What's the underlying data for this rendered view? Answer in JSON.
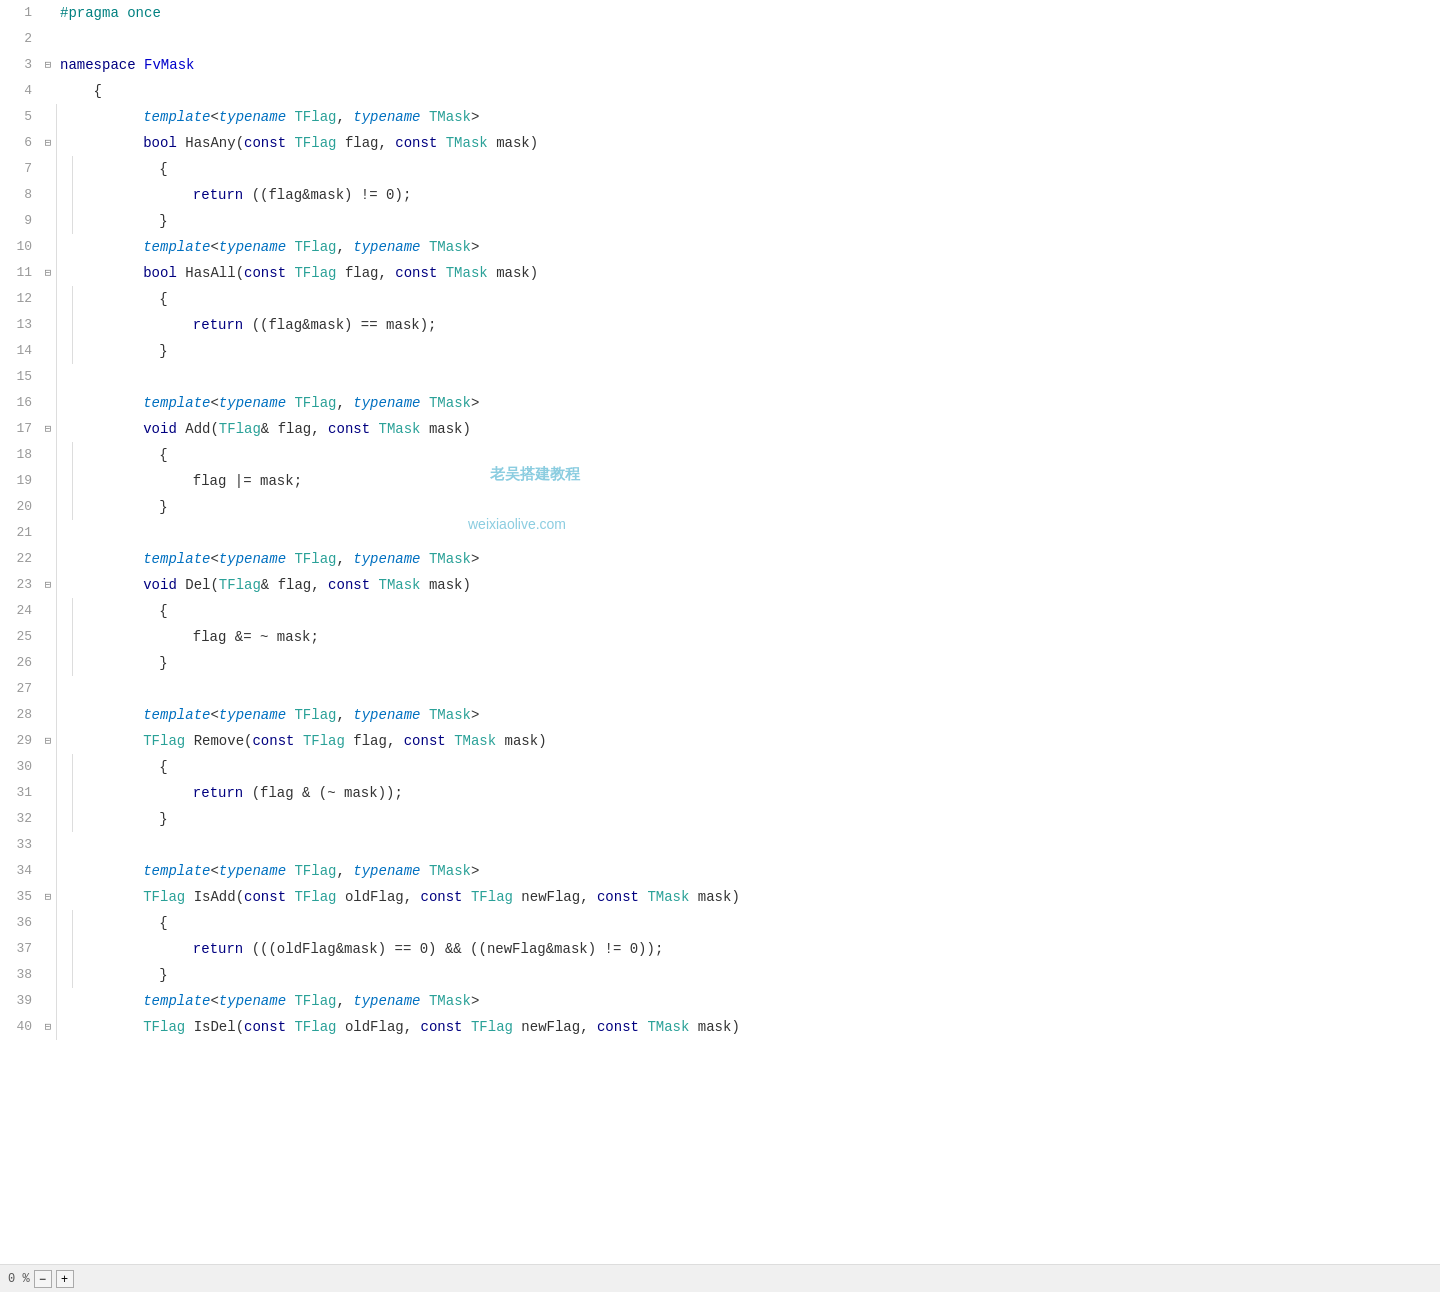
{
  "editor": {
    "lines": [
      {
        "num": "1",
        "fold": "",
        "indent": 0,
        "tokens": [
          {
            "t": "kw-pragma",
            "v": "#pragma once"
          }
        ]
      },
      {
        "num": "2",
        "fold": "",
        "indent": 0,
        "tokens": []
      },
      {
        "num": "3",
        "fold": "⊟",
        "indent": 0,
        "tokens": [
          {
            "t": "kw-namespace",
            "v": "namespace"
          },
          {
            "t": "normal",
            "v": " "
          },
          {
            "t": "ns-name",
            "v": "FvMask"
          }
        ]
      },
      {
        "num": "4",
        "fold": "",
        "indent": 0,
        "tokens": [
          {
            "t": "normal",
            "v": "    {"
          }
        ]
      },
      {
        "num": "5",
        "fold": "",
        "indent": 1,
        "tokens": [
          {
            "t": "normal",
            "v": "        "
          },
          {
            "t": "kw-template",
            "v": "template"
          },
          {
            "t": "normal",
            "v": "<"
          },
          {
            "t": "kw-typename",
            "v": "typename"
          },
          {
            "t": "normal",
            "v": " "
          },
          {
            "t": "kw-tparam",
            "v": "TFlag"
          },
          {
            "t": "normal",
            "v": ", "
          },
          {
            "t": "kw-typename",
            "v": "typename"
          },
          {
            "t": "normal",
            "v": " "
          },
          {
            "t": "kw-tparam",
            "v": "TMask"
          },
          {
            "t": "normal",
            "v": ">"
          }
        ]
      },
      {
        "num": "6",
        "fold": "⊟",
        "indent": 1,
        "tokens": [
          {
            "t": "normal",
            "v": "        "
          },
          {
            "t": "kw-bool",
            "v": "bool"
          },
          {
            "t": "normal",
            "v": " HasAny("
          },
          {
            "t": "kw-const",
            "v": "const"
          },
          {
            "t": "normal",
            "v": " "
          },
          {
            "t": "kw-tparam",
            "v": "TFlag"
          },
          {
            "t": "normal",
            "v": " flag, "
          },
          {
            "t": "kw-const",
            "v": "const"
          },
          {
            "t": "normal",
            "v": " "
          },
          {
            "t": "kw-tparam",
            "v": "TMask"
          },
          {
            "t": "normal",
            "v": " mask)"
          }
        ]
      },
      {
        "num": "7",
        "fold": "",
        "indent": 2,
        "tokens": [
          {
            "t": "normal",
            "v": "        {"
          }
        ]
      },
      {
        "num": "8",
        "fold": "",
        "indent": 2,
        "tokens": [
          {
            "t": "normal",
            "v": "            "
          },
          {
            "t": "kw-return",
            "v": "return"
          },
          {
            "t": "normal",
            "v": " ((flag&mask) != 0);"
          }
        ]
      },
      {
        "num": "9",
        "fold": "",
        "indent": 2,
        "tokens": [
          {
            "t": "normal",
            "v": "        }"
          }
        ]
      },
      {
        "num": "10",
        "fold": "",
        "indent": 1,
        "tokens": [
          {
            "t": "normal",
            "v": "        "
          },
          {
            "t": "kw-template",
            "v": "template"
          },
          {
            "t": "normal",
            "v": "<"
          },
          {
            "t": "kw-typename",
            "v": "typename"
          },
          {
            "t": "normal",
            "v": " "
          },
          {
            "t": "kw-tparam",
            "v": "TFlag"
          },
          {
            "t": "normal",
            "v": ", "
          },
          {
            "t": "kw-typename",
            "v": "typename"
          },
          {
            "t": "normal",
            "v": " "
          },
          {
            "t": "kw-tparam",
            "v": "TMask"
          },
          {
            "t": "normal",
            "v": ">"
          }
        ]
      },
      {
        "num": "11",
        "fold": "⊟",
        "indent": 1,
        "tokens": [
          {
            "t": "normal",
            "v": "        "
          },
          {
            "t": "kw-bool",
            "v": "bool"
          },
          {
            "t": "normal",
            "v": " HasAll("
          },
          {
            "t": "kw-const",
            "v": "const"
          },
          {
            "t": "normal",
            "v": " "
          },
          {
            "t": "kw-tparam",
            "v": "TFlag"
          },
          {
            "t": "normal",
            "v": " flag, "
          },
          {
            "t": "kw-const",
            "v": "const"
          },
          {
            "t": "normal",
            "v": " "
          },
          {
            "t": "kw-tparam",
            "v": "TMask"
          },
          {
            "t": "normal",
            "v": " mask)"
          }
        ]
      },
      {
        "num": "12",
        "fold": "",
        "indent": 2,
        "tokens": [
          {
            "t": "normal",
            "v": "        {"
          }
        ]
      },
      {
        "num": "13",
        "fold": "",
        "indent": 2,
        "tokens": [
          {
            "t": "normal",
            "v": "            "
          },
          {
            "t": "kw-return",
            "v": "return"
          },
          {
            "t": "normal",
            "v": " ((flag&mask) == mask);"
          }
        ]
      },
      {
        "num": "14",
        "fold": "",
        "indent": 2,
        "tokens": [
          {
            "t": "normal",
            "v": "        }"
          }
        ]
      },
      {
        "num": "15",
        "fold": "",
        "indent": 1,
        "tokens": []
      },
      {
        "num": "16",
        "fold": "",
        "indent": 1,
        "tokens": [
          {
            "t": "normal",
            "v": "        "
          },
          {
            "t": "kw-template",
            "v": "template"
          },
          {
            "t": "normal",
            "v": "<"
          },
          {
            "t": "kw-typename",
            "v": "typename"
          },
          {
            "t": "normal",
            "v": " "
          },
          {
            "t": "kw-tparam",
            "v": "TFlag"
          },
          {
            "t": "normal",
            "v": ", "
          },
          {
            "t": "kw-typename",
            "v": "typename"
          },
          {
            "t": "normal",
            "v": " "
          },
          {
            "t": "kw-tparam",
            "v": "TMask"
          },
          {
            "t": "normal",
            "v": ">"
          }
        ]
      },
      {
        "num": "17",
        "fold": "⊟",
        "indent": 1,
        "tokens": [
          {
            "t": "normal",
            "v": "        "
          },
          {
            "t": "kw-void",
            "v": "void"
          },
          {
            "t": "normal",
            "v": " Add("
          },
          {
            "t": "kw-tparam",
            "v": "TFlag"
          },
          {
            "t": "normal",
            "v": "& flag, "
          },
          {
            "t": "kw-const",
            "v": "const"
          },
          {
            "t": "normal",
            "v": " "
          },
          {
            "t": "kw-tparam",
            "v": "TMask"
          },
          {
            "t": "normal",
            "v": " mask)"
          }
        ]
      },
      {
        "num": "18",
        "fold": "",
        "indent": 2,
        "tokens": [
          {
            "t": "normal",
            "v": "        {"
          }
        ]
      },
      {
        "num": "19",
        "fold": "",
        "indent": 2,
        "tokens": [
          {
            "t": "normal",
            "v": "            flag |= mask;"
          }
        ]
      },
      {
        "num": "20",
        "fold": "",
        "indent": 2,
        "tokens": [
          {
            "t": "normal",
            "v": "        }"
          }
        ]
      },
      {
        "num": "21",
        "fold": "",
        "indent": 1,
        "tokens": []
      },
      {
        "num": "22",
        "fold": "",
        "indent": 1,
        "tokens": [
          {
            "t": "normal",
            "v": "        "
          },
          {
            "t": "kw-template",
            "v": "template"
          },
          {
            "t": "normal",
            "v": "<"
          },
          {
            "t": "kw-typename",
            "v": "typename"
          },
          {
            "t": "normal",
            "v": " "
          },
          {
            "t": "kw-tparam",
            "v": "TFlag"
          },
          {
            "t": "normal",
            "v": ", "
          },
          {
            "t": "kw-typename",
            "v": "typename"
          },
          {
            "t": "normal",
            "v": " "
          },
          {
            "t": "kw-tparam",
            "v": "TMask"
          },
          {
            "t": "normal",
            "v": ">"
          }
        ]
      },
      {
        "num": "23",
        "fold": "⊟",
        "indent": 1,
        "tokens": [
          {
            "t": "normal",
            "v": "        "
          },
          {
            "t": "kw-void",
            "v": "void"
          },
          {
            "t": "normal",
            "v": " Del("
          },
          {
            "t": "kw-tparam",
            "v": "TFlag"
          },
          {
            "t": "normal",
            "v": "& flag, "
          },
          {
            "t": "kw-const",
            "v": "const"
          },
          {
            "t": "normal",
            "v": " "
          },
          {
            "t": "kw-tparam",
            "v": "TMask"
          },
          {
            "t": "normal",
            "v": " mask)"
          }
        ]
      },
      {
        "num": "24",
        "fold": "",
        "indent": 2,
        "tokens": [
          {
            "t": "normal",
            "v": "        {"
          }
        ]
      },
      {
        "num": "25",
        "fold": "",
        "indent": 2,
        "tokens": [
          {
            "t": "normal",
            "v": "            flag &= ~ mask;"
          }
        ]
      },
      {
        "num": "26",
        "fold": "",
        "indent": 2,
        "tokens": [
          {
            "t": "normal",
            "v": "        }"
          }
        ]
      },
      {
        "num": "27",
        "fold": "",
        "indent": 1,
        "tokens": []
      },
      {
        "num": "28",
        "fold": "",
        "indent": 1,
        "tokens": [
          {
            "t": "normal",
            "v": "        "
          },
          {
            "t": "kw-template",
            "v": "template"
          },
          {
            "t": "normal",
            "v": "<"
          },
          {
            "t": "kw-typename",
            "v": "typename"
          },
          {
            "t": "normal",
            "v": " "
          },
          {
            "t": "kw-tparam",
            "v": "TFlag"
          },
          {
            "t": "normal",
            "v": ", "
          },
          {
            "t": "kw-typename",
            "v": "typename"
          },
          {
            "t": "normal",
            "v": " "
          },
          {
            "t": "kw-tparam",
            "v": "TMask"
          },
          {
            "t": "normal",
            "v": ">"
          }
        ]
      },
      {
        "num": "29",
        "fold": "⊟",
        "indent": 1,
        "tokens": [
          {
            "t": "normal",
            "v": "        "
          },
          {
            "t": "kw-tparam",
            "v": "TFlag"
          },
          {
            "t": "normal",
            "v": " Remove("
          },
          {
            "t": "kw-const",
            "v": "const"
          },
          {
            "t": "normal",
            "v": " "
          },
          {
            "t": "kw-tparam",
            "v": "TFlag"
          },
          {
            "t": "normal",
            "v": " flag, "
          },
          {
            "t": "kw-const",
            "v": "const"
          },
          {
            "t": "normal",
            "v": " "
          },
          {
            "t": "kw-tparam",
            "v": "TMask"
          },
          {
            "t": "normal",
            "v": " mask)"
          }
        ]
      },
      {
        "num": "30",
        "fold": "",
        "indent": 2,
        "tokens": [
          {
            "t": "normal",
            "v": "        {"
          }
        ]
      },
      {
        "num": "31",
        "fold": "",
        "indent": 2,
        "tokens": [
          {
            "t": "normal",
            "v": "            "
          },
          {
            "t": "kw-return",
            "v": "return"
          },
          {
            "t": "normal",
            "v": " (flag & (~ mask));"
          }
        ]
      },
      {
        "num": "32",
        "fold": "",
        "indent": 2,
        "tokens": [
          {
            "t": "normal",
            "v": "        }"
          }
        ]
      },
      {
        "num": "33",
        "fold": "",
        "indent": 1,
        "tokens": []
      },
      {
        "num": "34",
        "fold": "",
        "indent": 1,
        "tokens": [
          {
            "t": "normal",
            "v": "        "
          },
          {
            "t": "kw-template",
            "v": "template"
          },
          {
            "t": "normal",
            "v": "<"
          },
          {
            "t": "kw-typename",
            "v": "typename"
          },
          {
            "t": "normal",
            "v": " "
          },
          {
            "t": "kw-tparam",
            "v": "TFlag"
          },
          {
            "t": "normal",
            "v": ", "
          },
          {
            "t": "kw-typename",
            "v": "typename"
          },
          {
            "t": "normal",
            "v": " "
          },
          {
            "t": "kw-tparam",
            "v": "TMask"
          },
          {
            "t": "normal",
            "v": ">"
          }
        ]
      },
      {
        "num": "35",
        "fold": "⊟",
        "indent": 1,
        "tokens": [
          {
            "t": "normal",
            "v": "        "
          },
          {
            "t": "kw-tparam",
            "v": "TFlag"
          },
          {
            "t": "normal",
            "v": " IsAdd("
          },
          {
            "t": "kw-const",
            "v": "const"
          },
          {
            "t": "normal",
            "v": " "
          },
          {
            "t": "kw-tparam",
            "v": "TFlag"
          },
          {
            "t": "normal",
            "v": " oldFlag, "
          },
          {
            "t": "kw-const",
            "v": "const"
          },
          {
            "t": "normal",
            "v": " "
          },
          {
            "t": "kw-tparam",
            "v": "TFlag"
          },
          {
            "t": "normal",
            "v": " newFlag, "
          },
          {
            "t": "kw-const",
            "v": "const"
          },
          {
            "t": "normal",
            "v": " "
          },
          {
            "t": "kw-tparam",
            "v": "TMask"
          },
          {
            "t": "normal",
            "v": " mask)"
          }
        ]
      },
      {
        "num": "36",
        "fold": "",
        "indent": 2,
        "tokens": [
          {
            "t": "normal",
            "v": "        {"
          }
        ]
      },
      {
        "num": "37",
        "fold": "",
        "indent": 2,
        "tokens": [
          {
            "t": "normal",
            "v": "            "
          },
          {
            "t": "kw-return",
            "v": "return"
          },
          {
            "t": "normal",
            "v": " (((oldFlag&mask) == 0) && ((newFlag&mask) != 0));"
          }
        ]
      },
      {
        "num": "38",
        "fold": "",
        "indent": 2,
        "tokens": [
          {
            "t": "normal",
            "v": "        }"
          }
        ]
      },
      {
        "num": "39",
        "fold": "",
        "indent": 1,
        "tokens": [
          {
            "t": "normal",
            "v": "        "
          },
          {
            "t": "kw-template",
            "v": "template"
          },
          {
            "t": "normal",
            "v": "<"
          },
          {
            "t": "kw-typename",
            "v": "typename"
          },
          {
            "t": "normal",
            "v": " "
          },
          {
            "t": "kw-tparam",
            "v": "TFlag"
          },
          {
            "t": "normal",
            "v": ", "
          },
          {
            "t": "kw-typename",
            "v": "typename"
          },
          {
            "t": "normal",
            "v": " "
          },
          {
            "t": "kw-tparam",
            "v": "TMask"
          },
          {
            "t": "normal",
            "v": ">"
          }
        ]
      },
      {
        "num": "40",
        "fold": "⊟",
        "indent": 1,
        "tokens": [
          {
            "t": "normal",
            "v": "        "
          },
          {
            "t": "kw-tparam",
            "v": "TFlag"
          },
          {
            "t": "normal",
            "v": " IsDel("
          },
          {
            "t": "kw-const",
            "v": "const"
          },
          {
            "t": "normal",
            "v": " "
          },
          {
            "t": "kw-tparam",
            "v": "TFlag"
          },
          {
            "t": "normal",
            "v": " oldFlag, "
          },
          {
            "t": "kw-const",
            "v": "const"
          },
          {
            "t": "normal",
            "v": " "
          },
          {
            "t": "kw-tparam",
            "v": "TFlag"
          },
          {
            "t": "normal",
            "v": " newFlag, "
          },
          {
            "t": "kw-const",
            "v": "const"
          },
          {
            "t": "normal",
            "v": " "
          },
          {
            "t": "kw-tparam",
            "v": "TMask"
          },
          {
            "t": "normal",
            "v": " mask)"
          }
        ]
      }
    ],
    "watermark_1": "老吴搭建教程",
    "watermark_2": "weixiaolive.com",
    "bottom_zoom": "0 %",
    "bottom_minus": "−",
    "bottom_plus": "+"
  }
}
